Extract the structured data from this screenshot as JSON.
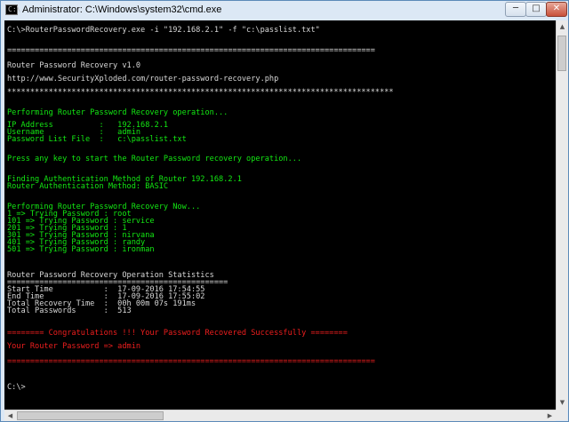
{
  "window": {
    "title": "Administrator: C:\\Windows\\system32\\cmd.exe",
    "icon_text": "C:\\",
    "minimize_glyph": "─",
    "maximize_glyph": "□",
    "close_glyph": "✕"
  },
  "scroll": {
    "up_glyph": "▲",
    "down_glyph": "▼",
    "left_glyph": "◀",
    "right_glyph": "▶"
  },
  "colors": {
    "console_bg": "#000000",
    "green": "#13e813",
    "red": "#f01e1e",
    "white": "#d8d8d8"
  },
  "console": {
    "command": "C:\\>RouterPasswordRecovery.exe -i \"192.168.2.1\" -f \"c:\\passlist.txt\"",
    "sep_long": "================================================================================",
    "banner_title": "Router Password Recovery v1.0",
    "banner_url": "http://www.SecurityXploded.com/router-password-recovery.php",
    "sep_star": "************************************************************************************",
    "performing": "Performing Router Password Recovery operation...",
    "ip_line": "IP Address          :   192.168.2.1",
    "username_line": "Username            :   admin",
    "passlist_line": "Password List File  :   c:\\passlist.txt",
    "press_key": "Press any key to start the Router Password recovery operation...",
    "finding_auth": "Finding Authentication Method of Router 192.168.2.1",
    "auth_method": "Router Authentication Method: BASIC",
    "performing_now": "Performing Router Password Recovery Now...",
    "tries": [
      "1 => Trying Password : root",
      "101 => Trying Password : service",
      "201 => Trying Password : 1",
      "301 => Trying Password : nirvana",
      "401 => Trying Password : randy",
      "501 => Trying Password : ironman"
    ],
    "stats_title": "Router Password Recovery Operation Statistics",
    "stats_sep": "================================================",
    "start_time": "Start Time           :  17-09-2016 17:54:55",
    "end_time": "End Time             :  17-09-2016 17:55:02",
    "total_recovery": "Total Recovery Time  :  00h 00m 07s 191ms",
    "total_passwords": "Total Passwords      :  513",
    "congrats": "======== Congratulations !!! Your Password Recovered Successfully ========",
    "your_password": "Your Router Password => admin",
    "red_sep": "================================================================================",
    "prompt": "C:\\>"
  }
}
